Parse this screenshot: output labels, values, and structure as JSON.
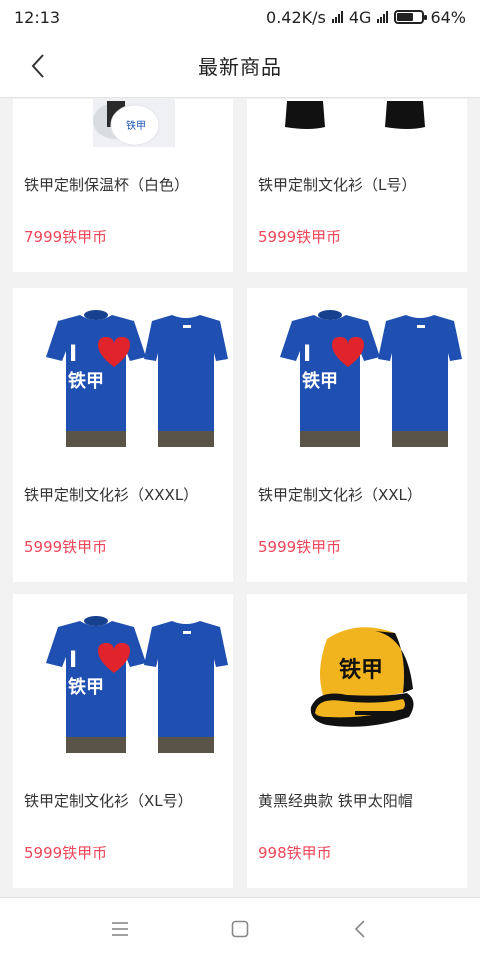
{
  "status_bar": {
    "time": "12:13",
    "network_speed": "0.42K/s",
    "network_type": "4G",
    "battery": "64%",
    "battery_level": 0.64
  },
  "header": {
    "title": "最新商品"
  },
  "products": [
    {
      "name": "铁甲定制保温杯（白色）",
      "price": "7999铁甲币",
      "image": "cup"
    },
    {
      "name": "铁甲定制文化衫（L号）",
      "price": "5999铁甲币",
      "image": "tshirt-black"
    },
    {
      "name": "铁甲定制文化衫（XXXL）",
      "price": "5999铁甲币",
      "image": "tshirt-blue"
    },
    {
      "name": "铁甲定制文化衫（XXL）",
      "price": "5999铁甲币",
      "image": "tshirt-blue"
    },
    {
      "name": "铁甲定制文化衫（XL号）",
      "price": "5999铁甲币",
      "image": "tshirt-blue"
    },
    {
      "name": "黄黑经典款 铁甲太阳帽",
      "price": "998铁甲币",
      "image": "cap"
    }
  ],
  "image_text": {
    "cup_logo": "铁甲",
    "shirt_logo_i": "I",
    "shirt_logo_name": "铁甲",
    "cap_logo": "铁甲"
  },
  "colors": {
    "price": "#f0465a",
    "shirt_blue": "#1f4fb0",
    "cap_yellow": "#f2b41e"
  },
  "nav_buttons": [
    "menu-icon",
    "home-icon",
    "back-icon"
  ]
}
